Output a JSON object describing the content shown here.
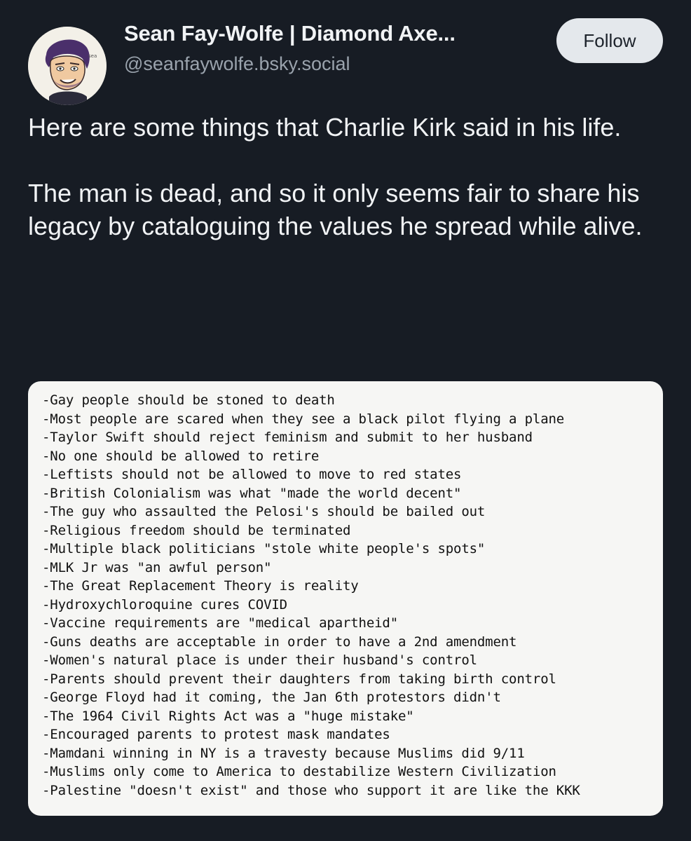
{
  "author": {
    "name": "Sean Fay-Wolfe | Diamond Axe...",
    "handle": "@seanfaywolfe.bsky.social",
    "avatar_icon": "cartoon-portrait-avatar"
  },
  "follow_label": "Follow",
  "post": {
    "paragraph_1": "Here are some things that Charlie Kirk said in his life.",
    "paragraph_2": "The man is dead, and so it only seems fair to share his legacy by cataloguing the values he spread while alive."
  },
  "image_lines": [
    "-Gay people should be stoned to death",
    "-Most people are scared when they see a black pilot flying a plane",
    "-Taylor Swift should reject feminism and submit to her husband",
    "-No one should be allowed to retire",
    "-Leftists should not be allowed to move to red states",
    "-British Colonialism was what \"made the world decent\"",
    "-The guy who assaulted the Pelosi's should be bailed out",
    "-Religious freedom should be terminated",
    "-Multiple black politicians \"stole white people's spots\"",
    "-MLK Jr was \"an awful person\"",
    "-The Great Replacement Theory is reality",
    "-Hydroxychloroquine cures COVID",
    "-Vaccine requirements are \"medical apartheid\"",
    "-Guns deaths are acceptable in order to have a 2nd amendment",
    "-Women's natural place is under their husband's control",
    "-Parents should prevent their daughters from taking birth control",
    "-George Floyd had it coming, the Jan 6th protestors didn't",
    "-The 1964 Civil Rights Act was a \"huge mistake\"",
    "-Encouraged parents to protest mask mandates",
    "-Mamdani winning in NY is a travesty because Muslims did 9/11",
    "-Muslims only come to America to destabilize Western Civilization",
    "-Palestine \"doesn't exist\" and those who support it are like the KKK"
  ],
  "colors": {
    "background": "#171c24",
    "text": "#f1f3f5",
    "handle": "#9aa3ad",
    "follow_bg": "#e4e8ec",
    "card_bg": "#f6f6f4"
  }
}
